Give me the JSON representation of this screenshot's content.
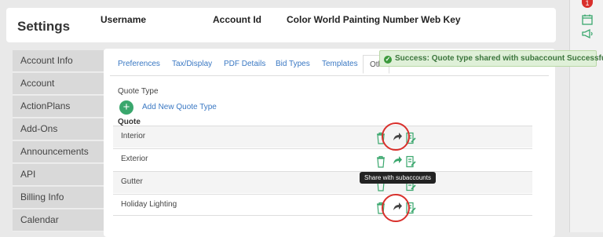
{
  "header": {
    "title": "Settings",
    "columns": [
      "Username",
      "Account Id",
      "Color World Painting Number Web Key"
    ]
  },
  "notification": {
    "count": "1"
  },
  "sidebar": {
    "items": [
      {
        "label": "Account Info"
      },
      {
        "label": "Account"
      },
      {
        "label": "ActionPlans"
      },
      {
        "label": "Add-Ons"
      },
      {
        "label": "Announcements"
      },
      {
        "label": "API"
      },
      {
        "label": "Billing Info"
      },
      {
        "label": "Calendar"
      }
    ]
  },
  "tabs": [
    {
      "label": "Preferences"
    },
    {
      "label": "Tax/Display"
    },
    {
      "label": "PDF Details"
    },
    {
      "label": "Bid Types"
    },
    {
      "label": "Templates"
    },
    {
      "label": "Oth"
    }
  ],
  "toast": {
    "message": "Success: Quote type shared with subaccount Successfully."
  },
  "section": {
    "label": "Quote Type",
    "add_label": "Add New Quote Type",
    "column_header": "Quote"
  },
  "quotes": [
    {
      "name": "Interior"
    },
    {
      "name": "Exterior"
    },
    {
      "name": "Gutter"
    },
    {
      "name": "Holiday Lighting"
    }
  ],
  "tooltip": {
    "text": "Share with subaccounts"
  },
  "colors": {
    "accent": "#3a78c3",
    "success_bg": "#dff0d8",
    "action_green": "#3aa76d",
    "highlight_red": "#d9302c"
  }
}
